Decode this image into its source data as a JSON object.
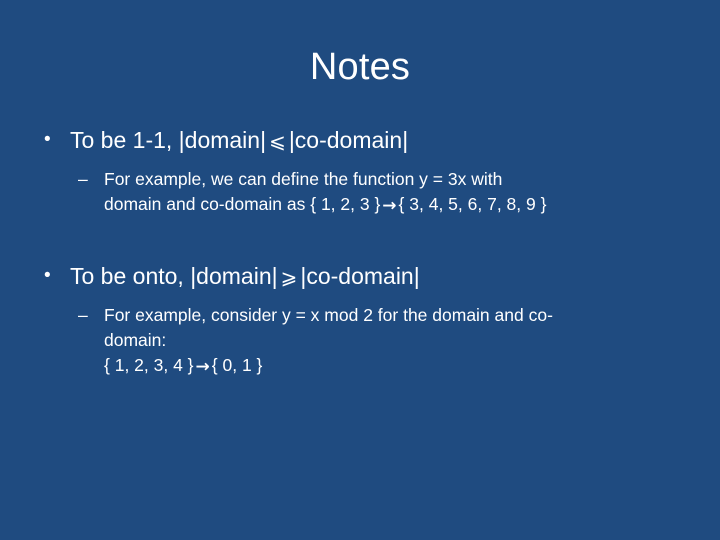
{
  "slide": {
    "title": "Notes",
    "background_color": "#1F4B80",
    "text_color": "#FFFFFF",
    "bullet_marker": "•",
    "dash_marker": "–",
    "arrow_glyph": "→",
    "bullets": [
      {
        "level": 1,
        "text": "To be 1-1, |domain| ⩽ |co-domain|",
        "text_before_relation": "To be 1-1, |domain|",
        "relation": "⩽",
        "text_after_relation": "|co-domain|"
      },
      {
        "level": 2,
        "line1": "For example, we can define the function y = 3x with",
        "line2_before_arrow": "domain and co-domain as { 1, 2, 3 }",
        "line2_after_arrow": "{ 3, 4, 5, 6, 7, 8, 9 }"
      },
      {
        "level": 1,
        "text": "To be onto, |domain| ⩾ |co-domain|",
        "text_before_relation": "To be onto, |domain|",
        "relation": "⩾",
        "text_after_relation": "|co-domain|"
      },
      {
        "level": 2,
        "line1": "For example, consider y = x mod 2 for the domain and co-",
        "line2": "domain:",
        "line3_before_arrow": "{ 1, 2, 3, 4 }",
        "line3_after_arrow": "{ 0, 1 }"
      }
    ]
  }
}
